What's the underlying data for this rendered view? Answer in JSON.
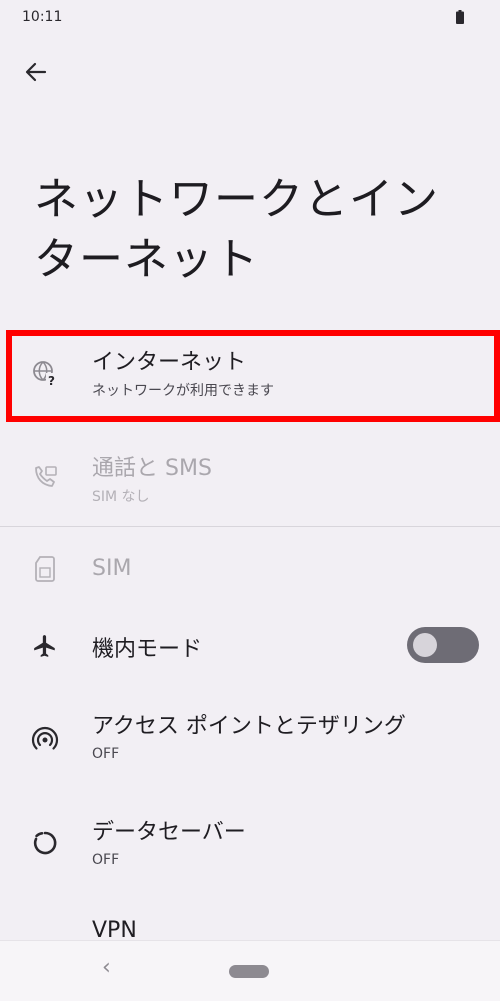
{
  "status_bar": {
    "time": "10:11",
    "battery_icon": "battery-icon"
  },
  "header": {
    "back_icon": "arrow-back-icon",
    "title_line1": "ネットワークとイン",
    "title_line2": "ターネット"
  },
  "items": [
    {
      "icon": "globe-question-icon",
      "title": "インターネット",
      "subtitle": "ネットワークが利用できます",
      "enabled": true
    },
    {
      "icon": "phone-message-icon",
      "title": "通話と SMS",
      "subtitle": "SIM なし",
      "enabled": false
    },
    {
      "icon": "sim-card-icon",
      "title": "SIM",
      "enabled": false
    },
    {
      "icon": "airplane-icon",
      "title": "機内モード",
      "enabled": true,
      "toggle_on": false
    },
    {
      "icon": "hotspot-icon",
      "title": "アクセス ポイントとテザリング",
      "subtitle": "OFF",
      "enabled": true
    },
    {
      "icon": "data-saver-icon",
      "title": "データセーバー",
      "subtitle": "OFF",
      "enabled": true
    },
    {
      "icon": "vpn-key-icon",
      "title": "VPN",
      "enabled": true
    }
  ],
  "highlight_color": "#ff0000",
  "nav_bar": {
    "back_glyph": "‹"
  }
}
